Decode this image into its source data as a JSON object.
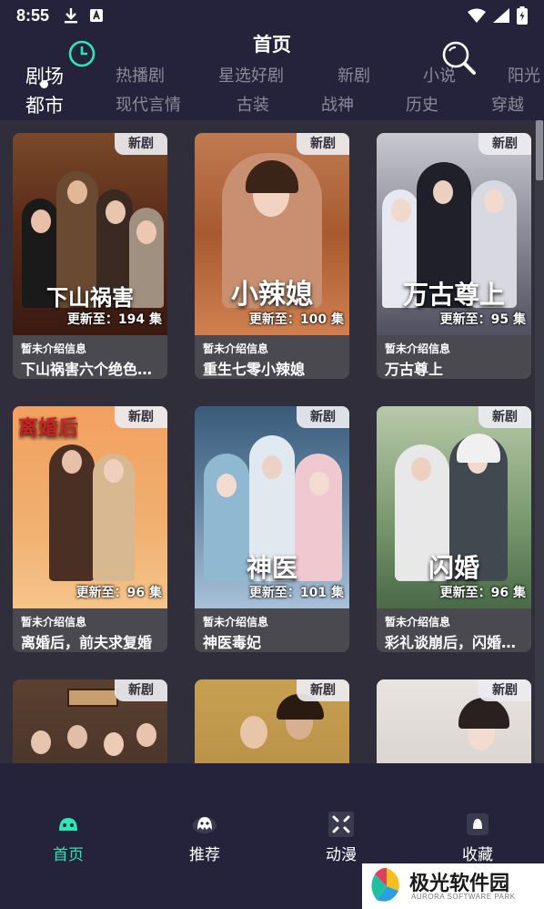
{
  "status": {
    "time": "8:55"
  },
  "header": {
    "title": "首页",
    "categories_row1": [
      "剧场",
      "热播剧",
      "星选好剧",
      "新剧",
      "小说",
      "阳光"
    ],
    "categories_row2": [
      "都市",
      "现代言情",
      "古装",
      "战神",
      "历史",
      "穿越"
    ]
  },
  "cards": [
    {
      "badge": "新剧",
      "poster_text": "下山祸害",
      "episodes": "更新至：194 集",
      "desc": "暂未介绍信息",
      "name": "下山祸害六个绝色师姐"
    },
    {
      "badge": "新剧",
      "poster_text": "小辣媳",
      "episodes": "更新至：100 集",
      "desc": "暂未介绍信息",
      "name": "重生七零小辣媳"
    },
    {
      "badge": "新剧",
      "poster_text": "万古尊上",
      "episodes": "更新至：95 集",
      "desc": "暂未介绍信息",
      "name": "万古尊上"
    },
    {
      "badge": "新剧",
      "poster_text": "离婚后",
      "episodes": "更新至：96 集",
      "desc": "暂未介绍信息",
      "name": "离婚后，前夫求复婚"
    },
    {
      "badge": "新剧",
      "poster_text": "神医",
      "episodes": "更新至：101 集",
      "desc": "暂未介绍信息",
      "name": "神医毒妃"
    },
    {
      "badge": "新剧",
      "poster_text": "闪婚",
      "episodes": "更新至：96 集",
      "desc": "暂未介绍信息",
      "name": "彩礼谈崩后，闪婚神秘首富"
    },
    {
      "badge": "新剧",
      "poster_text": "",
      "episodes": "",
      "desc": "",
      "name": ""
    },
    {
      "badge": "新剧",
      "poster_text": "",
      "episodes": "",
      "desc": "",
      "name": ""
    },
    {
      "badge": "新剧",
      "poster_text": "",
      "episodes": "",
      "desc": "",
      "name": ""
    }
  ],
  "nav": [
    {
      "label": "首页",
      "icon": "home-robot-icon",
      "active": true
    },
    {
      "label": "推荐",
      "icon": "ghost-icon",
      "active": false
    },
    {
      "label": "动漫",
      "icon": "grid-icon",
      "active": false
    },
    {
      "label": "收藏",
      "icon": "bookmark-icon",
      "active": false
    }
  ],
  "watermark": {
    "title": "极光软件园",
    "subtitle": "AURORA SOFTWARE PARK"
  },
  "colors": {
    "accent": "#2ee6b6",
    "header_bg": "#24233b",
    "page_bg": "#2f2e3a"
  }
}
